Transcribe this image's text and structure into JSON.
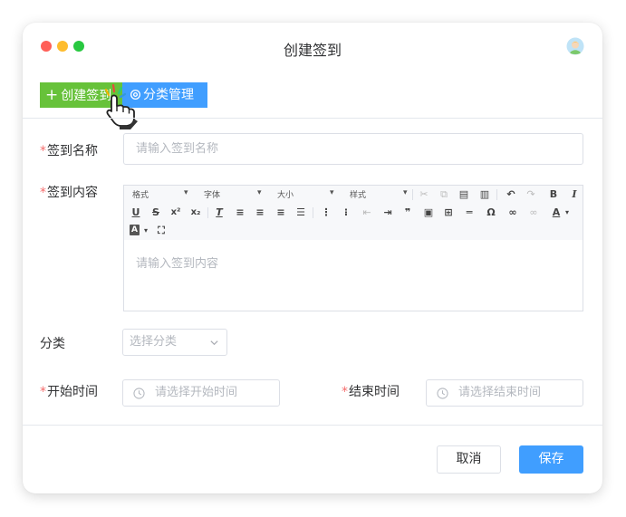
{
  "window": {
    "title": "创建签到"
  },
  "toolbar": {
    "create_label": "创建签到",
    "category_manage_label": "分类管理"
  },
  "form": {
    "name": {
      "label": "签到名称",
      "placeholder": "请输入签到名称"
    },
    "content": {
      "label": "签到内容",
      "placeholder": "请输入签到内容",
      "dropdowns": [
        "格式",
        "字体",
        "大小",
        "样式"
      ]
    },
    "category": {
      "label": "分类",
      "placeholder": "选择分类"
    },
    "start_time": {
      "label": "开始时间",
      "placeholder": "请选择开始时间"
    },
    "end_time": {
      "label": "结束时间",
      "placeholder": "请选择结束时间"
    }
  },
  "footer": {
    "cancel_label": "取消",
    "save_label": "保存"
  },
  "colors": {
    "primary": "#409eff",
    "success": "#67c23a",
    "required": "#f56c6c",
    "border": "#dcdfe6"
  }
}
